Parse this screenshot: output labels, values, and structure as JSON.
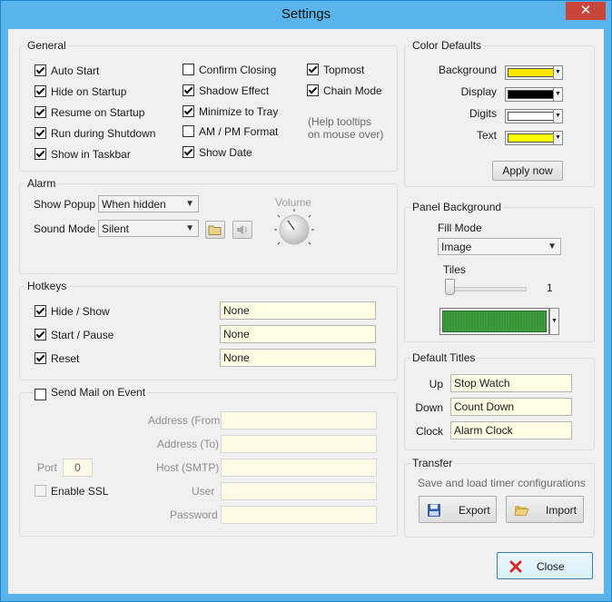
{
  "window": {
    "title": "Settings",
    "close_glyph": "✕"
  },
  "general": {
    "legend": "General",
    "col1": [
      {
        "label": "Auto Start",
        "checked": true
      },
      {
        "label": "Hide on Startup",
        "checked": true
      },
      {
        "label": "Resume on Startup",
        "checked": true
      },
      {
        "label": "Run during Shutdown",
        "checked": true
      },
      {
        "label": "Show in Taskbar",
        "checked": true
      }
    ],
    "col2": [
      {
        "label": "Confirm Closing",
        "checked": false
      },
      {
        "label": "Shadow Effect",
        "checked": true
      },
      {
        "label": "Minimize to Tray",
        "checked": true
      },
      {
        "label": "AM / PM Format",
        "checked": false
      },
      {
        "label": "Show Date",
        "checked": true
      }
    ],
    "col3": [
      {
        "label": "Topmost",
        "checked": true
      },
      {
        "label": "Chain Mode",
        "checked": true
      }
    ],
    "hint_line1": "(Help tooltips",
    "hint_line2": "on mouse over)"
  },
  "alarm": {
    "legend": "Alarm",
    "show_popup_label": "Show Popup",
    "show_popup_value": "When hidden",
    "sound_mode_label": "Sound Mode",
    "sound_mode_value": "Silent",
    "volume_label": "Volume"
  },
  "hotkeys": {
    "legend": "Hotkeys",
    "items": [
      {
        "label": "Hide / Show",
        "value": "None",
        "checked": true
      },
      {
        "label": "Start / Pause",
        "value": "None",
        "checked": true
      },
      {
        "label": "Reset",
        "value": "None",
        "checked": true
      }
    ]
  },
  "mail": {
    "legend": "Send Mail on Event",
    "checked": false,
    "address_from": "Address (From)",
    "address_to": "Address (To)",
    "host": "Host (SMTP)",
    "user": "User",
    "password": "Password",
    "port_label": "Port",
    "port_value": "0",
    "enable_ssl": "Enable SSL"
  },
  "color_defaults": {
    "legend": "Color Defaults",
    "items": [
      {
        "label": "Background",
        "color": "#ffe600"
      },
      {
        "label": "Display",
        "color": "#000000"
      },
      {
        "label": "Digits",
        "color": "#ffffff"
      },
      {
        "label": "Text",
        "color": "#ffff00"
      }
    ],
    "apply_label": "Apply now"
  },
  "panel_background": {
    "legend": "Panel Background",
    "fill_mode_label": "Fill Mode",
    "fill_mode_value": "Image",
    "tiles_label": "Tiles",
    "tiles_value": "1",
    "preview_color": "#3a9a3a"
  },
  "default_titles": {
    "legend": "Default Titles",
    "items": [
      {
        "label": "Up",
        "value": "Stop Watch"
      },
      {
        "label": "Down",
        "value": "Count Down"
      },
      {
        "label": "Clock",
        "value": "Alarm Clock"
      }
    ]
  },
  "transfer": {
    "legend": "Transfer",
    "desc": "Save and load timer configurations",
    "export_label": "Export",
    "import_label": "Import"
  },
  "close_button": {
    "label": "Close"
  }
}
